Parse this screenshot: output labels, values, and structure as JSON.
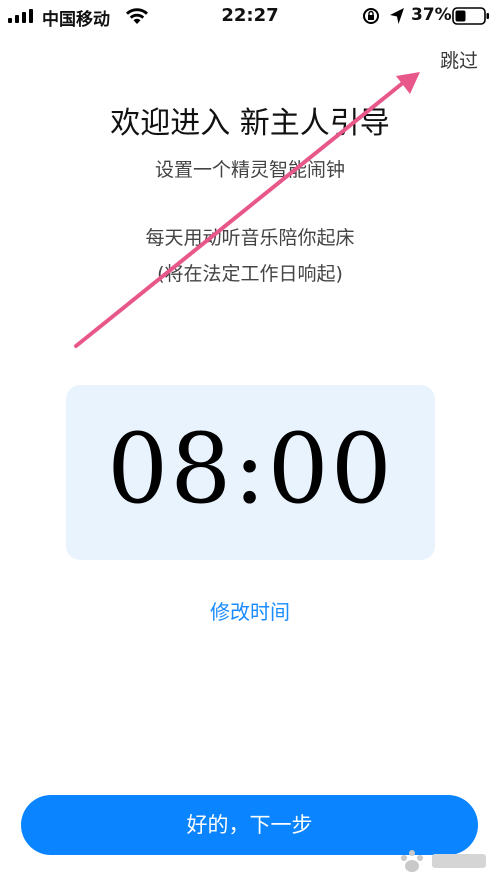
{
  "status_bar": {
    "carrier": "中国移动",
    "time": "22:27",
    "battery_percent": "37%",
    "battery_level": 0.37
  },
  "header": {
    "skip_label": "跳过"
  },
  "intro": {
    "title": "欢迎进入 新主人引导",
    "subtitle": "设置一个精灵智能闹钟",
    "description_line1": "每天用动听音乐陪你起床",
    "description_line2": "(将在法定工作日响起)"
  },
  "alarm": {
    "time": "08:00"
  },
  "actions": {
    "modify_time_label": "修改时间",
    "next_button_label": "好的，下一步"
  },
  "colors": {
    "accent": "#0a84ff",
    "link": "#1a8cff",
    "card_bg": "#e9f3fe",
    "annotation_arrow": "#e8578a"
  }
}
